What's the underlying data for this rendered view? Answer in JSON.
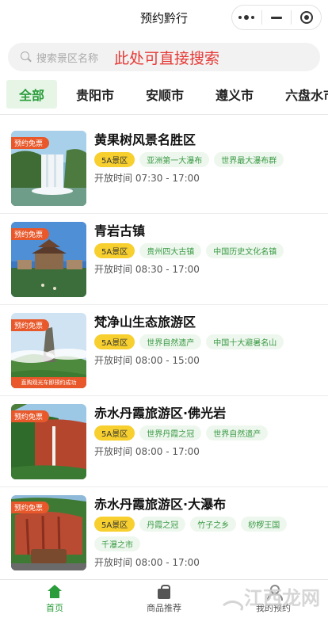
{
  "header": {
    "title": "预约黔行"
  },
  "search": {
    "placeholder": "搜索景区名称",
    "hint": "此处可直接搜索"
  },
  "tabs": [
    {
      "label": "全部",
      "active": true
    },
    {
      "label": "贵阳市",
      "active": false
    },
    {
      "label": "安顺市",
      "active": false
    },
    {
      "label": "遵义市",
      "active": false
    },
    {
      "label": "六盘水市",
      "active": false
    }
  ],
  "scenics": [
    {
      "badge": "预约免票",
      "name": "黄果树风景名胜区",
      "tags": [
        "5A景区",
        "亚洲第一大瀑布",
        "世界最大瀑布群"
      ],
      "hours": "开放时间  07:30 - 17:00",
      "image": "waterfall-icon"
    },
    {
      "badge": "预约免票",
      "name": "青岩古镇",
      "tags": [
        "5A景区",
        "贵州四大古镇",
        "中国历史文化名镇"
      ],
      "hours": "开放时间  08:30 - 17:00",
      "image": "ancient-town-icon"
    },
    {
      "badge": "预约免票",
      "name": "梵净山生态旅游区",
      "tags": [
        "5A景区",
        "世界自然遗产",
        "中国十大避暑名山"
      ],
      "hours": "开放时间  08:00 - 15:00",
      "banner": "直购观光车即预约成功",
      "image": "mountain-icon"
    },
    {
      "badge": "预约免票",
      "name": "赤水丹霞旅游区·佛光岩",
      "tags": [
        "5A景区",
        "世界丹霞之冠",
        "世界自然遗产"
      ],
      "hours": "开放时间  08:00 - 17:00",
      "image": "red-cliff-icon"
    },
    {
      "badge": "预约免票",
      "name": "赤水丹霞旅游区·大瀑布",
      "tags": [
        "5A景区",
        "丹霞之冠",
        "竹子之乡",
        "桫椤王国",
        "千瀑之市"
      ],
      "hours": "开放时间  08:00 - 17:00",
      "image": "red-cliff-fall-icon"
    }
  ],
  "bottom_nav": [
    {
      "label": "首页",
      "icon": "home-icon",
      "active": true
    },
    {
      "label": "商品推荐",
      "icon": "bag-icon",
      "active": false
    },
    {
      "label": "我的预约",
      "icon": "user-icon",
      "active": false
    }
  ],
  "watermark": {
    "text": "江西龙网"
  },
  "colors": {
    "accent": "#2a9d3a",
    "level_tag": "#f7cf2e",
    "badge": "#e8582a",
    "hint": "#e53935"
  }
}
